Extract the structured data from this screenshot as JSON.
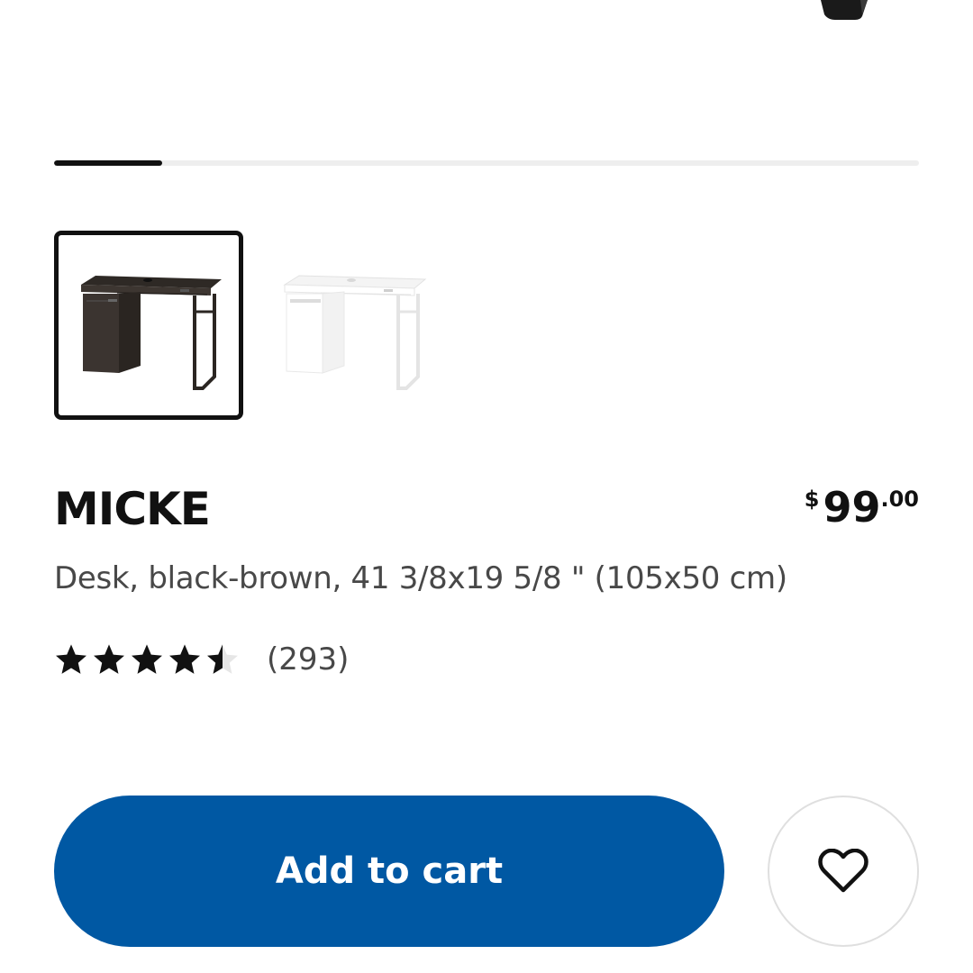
{
  "carousel": {
    "progress_fraction": 0.125
  },
  "variants": [
    {
      "name": "black-brown",
      "selected": true,
      "color": "#3a342f"
    },
    {
      "name": "white",
      "selected": false,
      "color": "#ffffff"
    }
  ],
  "product": {
    "name": "MICKE",
    "description": "Desk, black-brown, 41 3/8x19 5/8 \" (105x50 cm)",
    "price": {
      "currency": "$",
      "integer": "99",
      "decimals": ".00"
    },
    "rating": {
      "value": 4.5,
      "max": 5,
      "review_count": "(293)"
    }
  },
  "actions": {
    "add_to_cart_label": "Add to cart",
    "favourite_icon": "heart-outline-icon"
  },
  "colors": {
    "accent": "#0058a3",
    "text_primary": "#111111",
    "text_secondary": "#484848"
  }
}
